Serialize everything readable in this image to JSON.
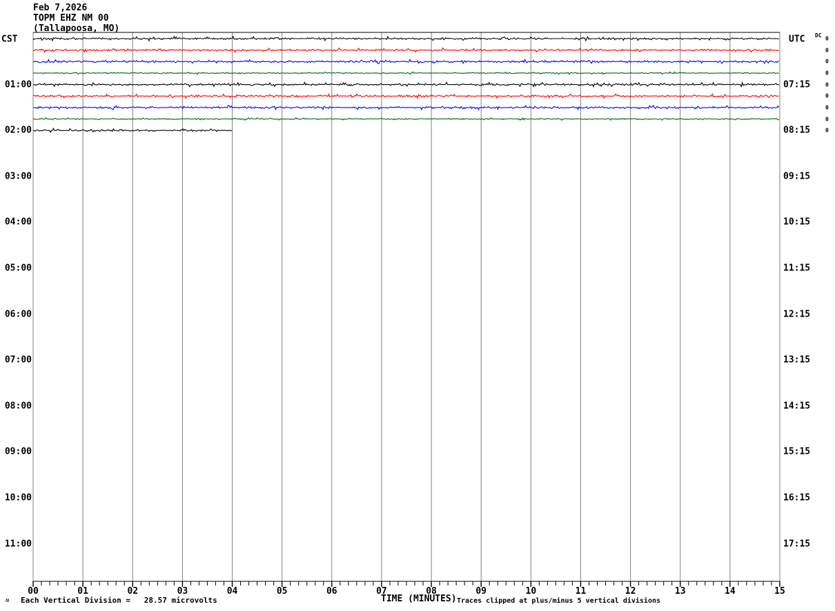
{
  "header": {
    "date": "Feb 7,2026",
    "station": "TOPM EHZ NM 00",
    "location": "(Tallapoosa, MO)"
  },
  "left_axis": {
    "tz_label": "CST",
    "times": [
      "01:00",
      "02:00",
      "03:00",
      "04:00",
      "05:00",
      "06:00",
      "07:00",
      "08:00",
      "09:00",
      "10:00",
      "11:00"
    ]
  },
  "right_axis": {
    "tz_label": "UTC",
    "dc_label": "DC",
    "times": [
      "07:15",
      "08:15",
      "09:15",
      "10:15",
      "11:15",
      "12:15",
      "13:15",
      "14:15",
      "15:15",
      "16:15",
      "17:15"
    ],
    "dc_values": [
      "0",
      "0",
      "0",
      "0",
      "0",
      "0",
      "0",
      "0",
      "0"
    ]
  },
  "bottom_axis": {
    "title": "TIME (MINUTES)",
    "labels": [
      "00",
      "01",
      "02",
      "03",
      "04",
      "05",
      "06",
      "07",
      "08",
      "09",
      "10",
      "11",
      "12",
      "13",
      "14",
      "15"
    ]
  },
  "footer": {
    "scale_note": "Each Vertical Division =   28.57 microvolts",
    "clip_note": "Traces clipped at plus/minus 5 vertical divisions",
    "logo_glyph": "ʍ"
  },
  "colors": {
    "grid": "#808080",
    "frame": "#000000",
    "trace_black": "#000000",
    "trace_red": "#ff0000",
    "trace_blue": "#0000ff",
    "trace_green": "#006600"
  },
  "chart_data": {
    "type": "line",
    "variant": "helicorder-seismogram",
    "title": "TOPM EHZ NM 00 (Tallapoosa, MO) Feb 7,2026",
    "xlabel": "TIME (MINUTES)",
    "x_range": [
      0,
      15
    ],
    "x_major_tick": 1,
    "x_minor_divisions_per_major": 6,
    "minutes_per_row": 15,
    "rows_per_hour": 4,
    "scale_microvolts_per_division": 28.57,
    "clip_divisions": 5,
    "grid": "vertical-only",
    "traces": [
      {
        "row": 0,
        "color": "#000000",
        "start_min": 0,
        "end_min": 15,
        "dc_offset": 0,
        "mean": 0,
        "amplitude": 0.05
      },
      {
        "row": 1,
        "color": "#ff0000",
        "start_min": 0,
        "end_min": 15,
        "dc_offset": 0,
        "mean": 0,
        "amplitude": 0.05
      },
      {
        "row": 2,
        "color": "#0000ff",
        "start_min": 0,
        "end_min": 15,
        "dc_offset": 0,
        "mean": 0,
        "amplitude": 0.05
      },
      {
        "row": 3,
        "color": "#006600",
        "start_min": 0,
        "end_min": 15,
        "dc_offset": 0,
        "mean": 0,
        "amplitude": 0.03
      },
      {
        "row": 4,
        "color": "#000000",
        "start_min": 0,
        "end_min": 15,
        "dc_offset": 0,
        "mean": 0,
        "amplitude": 0.05
      },
      {
        "row": 5,
        "color": "#ff0000",
        "start_min": 0,
        "end_min": 15,
        "dc_offset": 0,
        "mean": 0,
        "amplitude": 0.05
      },
      {
        "row": 6,
        "color": "#0000ff",
        "start_min": 0,
        "end_min": 15,
        "dc_offset": 0,
        "mean": 0,
        "amplitude": 0.05
      },
      {
        "row": 7,
        "color": "#006600",
        "start_min": 0,
        "end_min": 15,
        "dc_offset": 0,
        "mean": 0,
        "amplitude": 0.03
      },
      {
        "row": 8,
        "color": "#000000",
        "start_min": 0,
        "end_min": 4,
        "dc_offset": 0,
        "mean": 0,
        "amplitude": 0.05
      }
    ]
  }
}
